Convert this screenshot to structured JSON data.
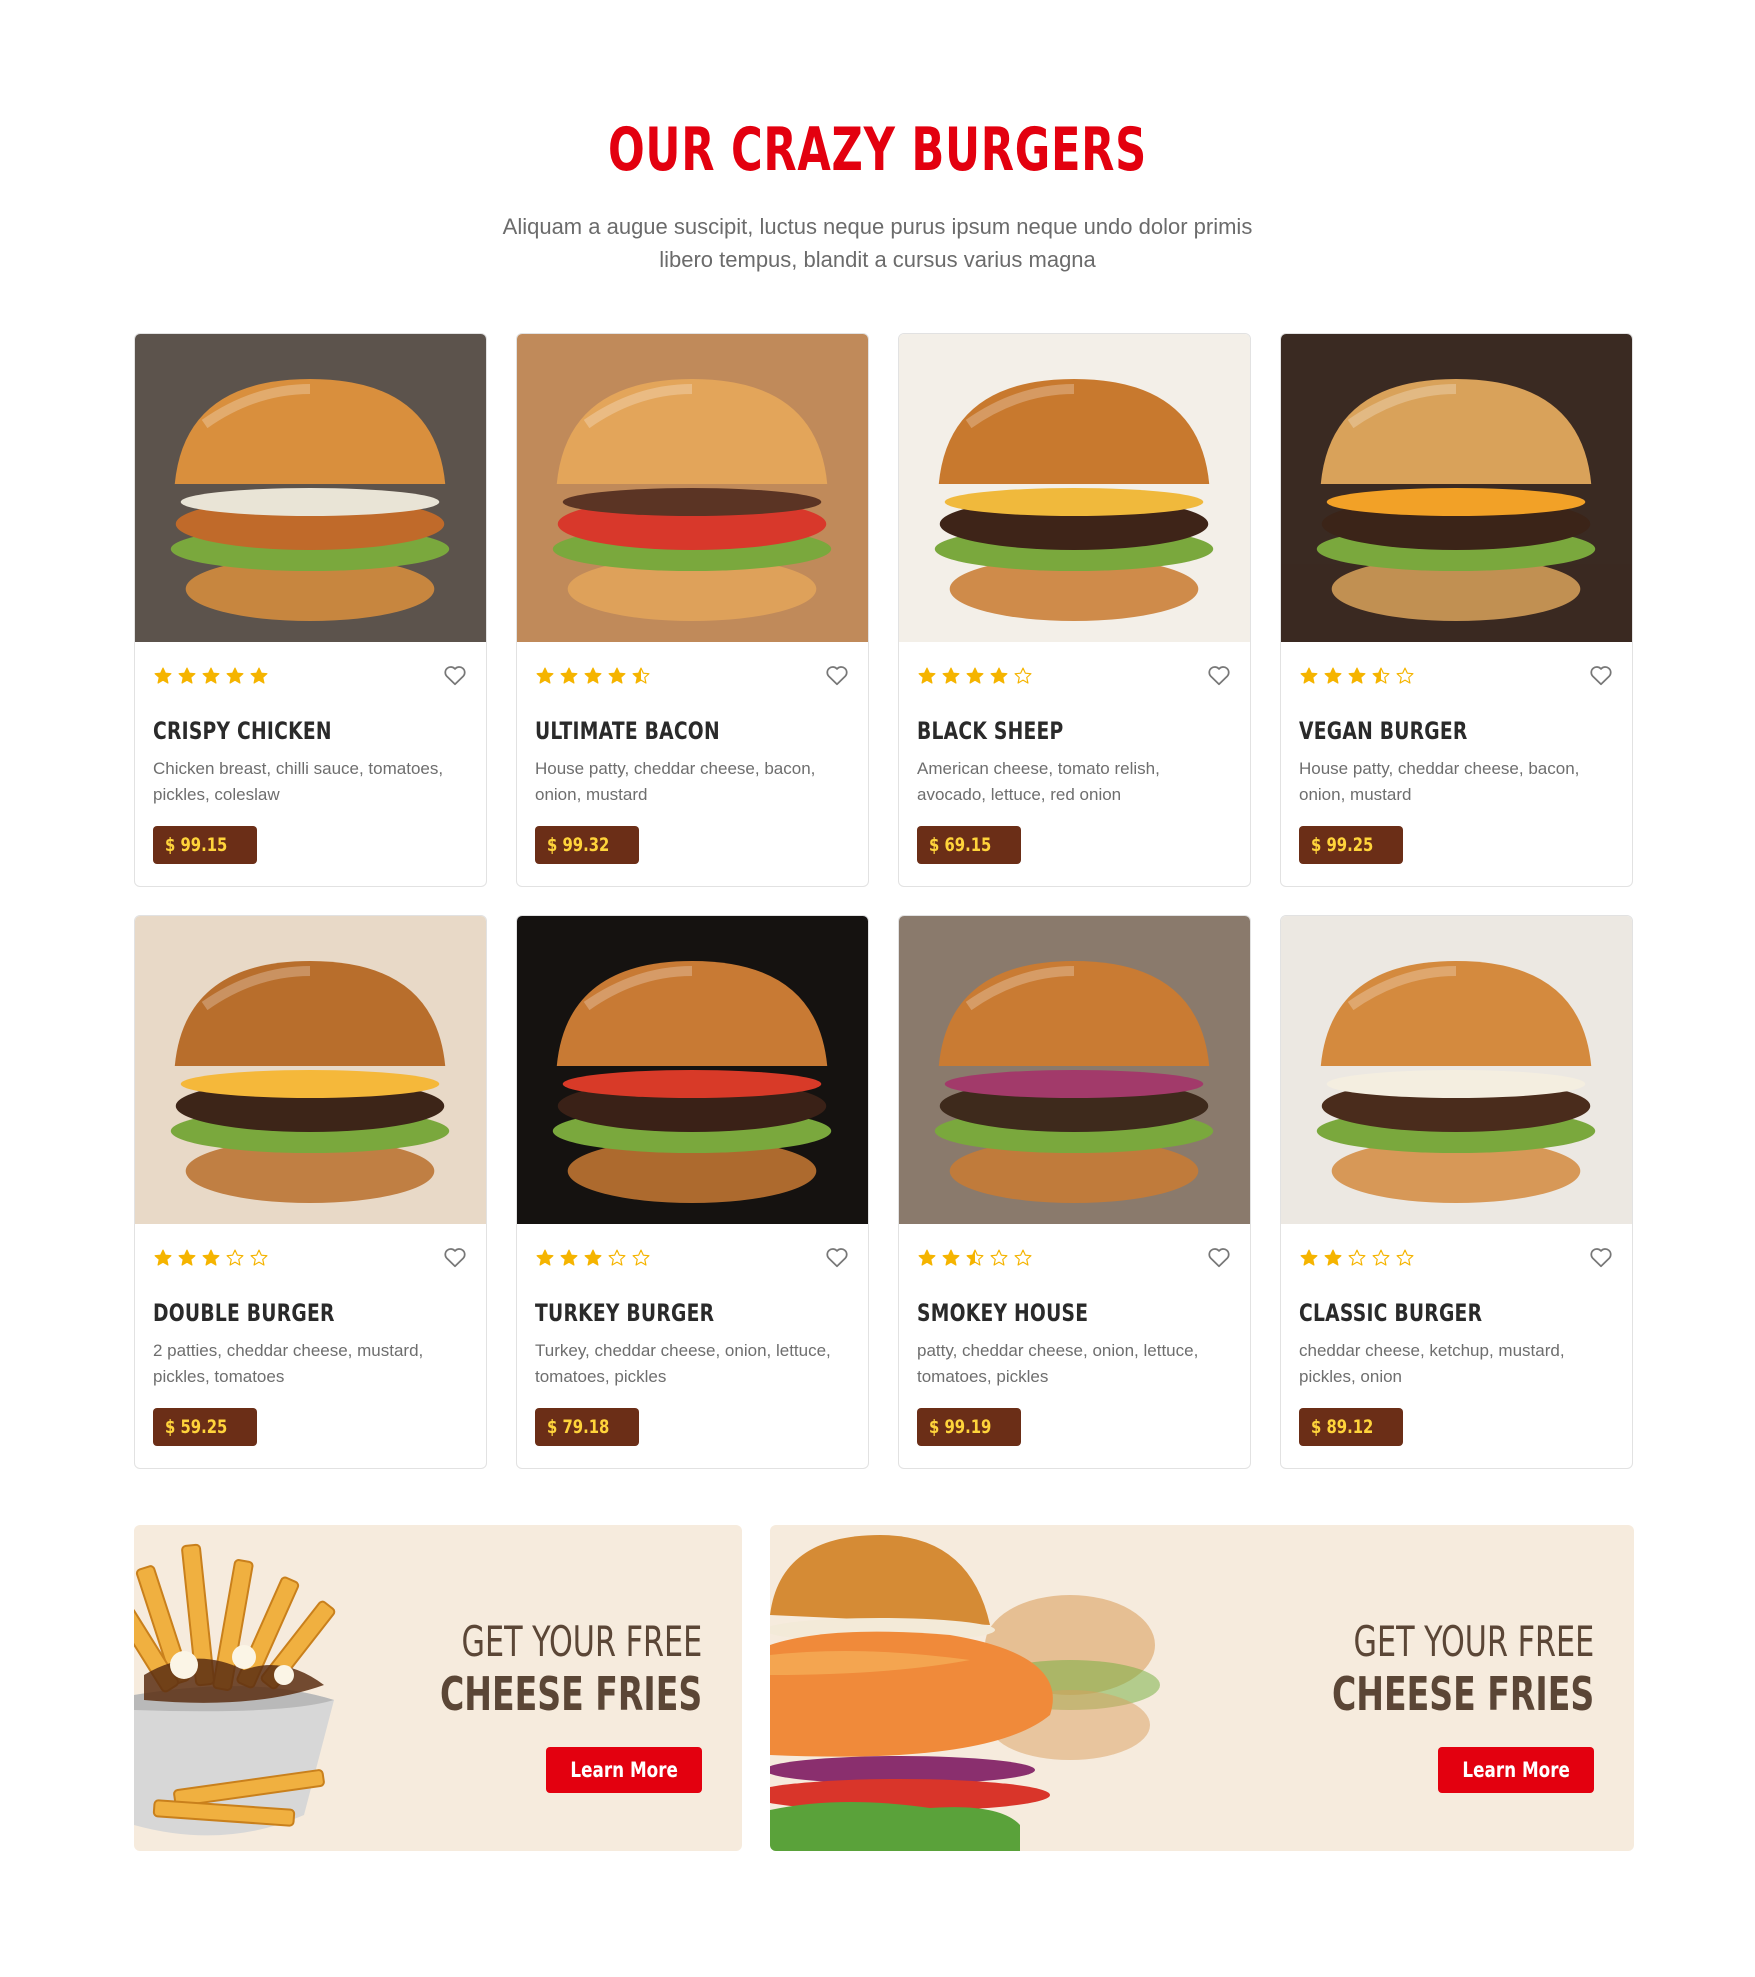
{
  "section": {
    "title": "OUR CRAZY BURGERS",
    "subtitle": "Aliquam a augue suscipit, luctus neque purus ipsum neque undo dolor primis libero tempus, blandit a cursus varius magna"
  },
  "products": [
    {
      "name": "CRISPY CHICKEN",
      "description": "Chicken breast, chilli sauce, tomatoes, pickles, coleslaw",
      "price": "$ 99.15",
      "rating": 5
    },
    {
      "name": "ULTIMATE BACON",
      "description": "House patty, cheddar cheese, bacon, onion, mustard",
      "price": "$ 99.32",
      "rating": 4.5
    },
    {
      "name": "BLACK SHEEP",
      "description": "American cheese, tomato relish, avocado, lettuce, red onion",
      "price": "$ 69.15",
      "rating": 4
    },
    {
      "name": "VEGAN BURGER",
      "description": "House patty, cheddar cheese, bacon, onion, mustard",
      "price": "$ 99.25",
      "rating": 3.5
    },
    {
      "name": "DOUBLE BURGER",
      "description": "2 patties, cheddar cheese, mustard, pickles, tomatoes",
      "price": "$ 59.25",
      "rating": 3
    },
    {
      "name": "TURKEY BURGER",
      "description": "Turkey, cheddar cheese, onion, lettuce, tomatoes, pickles",
      "price": "$ 79.18",
      "rating": 3
    },
    {
      "name": "SMOKEY HOUSE",
      "description": "patty, cheddar cheese, onion, lettuce, tomatoes, pickles",
      "price": "$ 99.19",
      "rating": 2.5
    },
    {
      "name": "CLASSIC BURGER",
      "description": "cheddar cheese, ketchup, mustard, pickles, onion",
      "price": "$ 89.12",
      "rating": 2
    }
  ],
  "promos": [
    {
      "line1": "GET YOUR FREE",
      "line2": "CHEESE FRIES",
      "button": "Learn More"
    },
    {
      "line1": "GET YOUR FREE",
      "line2": "CHEESE FRIES",
      "button": "Learn More"
    }
  ],
  "colors": {
    "accent": "#e3000f",
    "star": "#f5b400",
    "price_bg": "#6b2e17",
    "price_text": "#ffd43b",
    "promo_bg": "#f6ebdd"
  },
  "icons": {
    "rating": "star-icon",
    "favorite": "heart-icon"
  }
}
